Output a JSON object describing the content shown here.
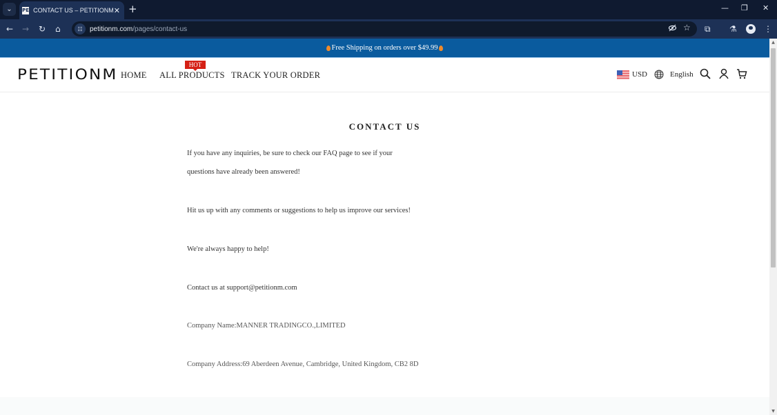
{
  "browser": {
    "tab_title": "CONTACT US – PETITIONM",
    "tab_favicon": "PE",
    "url_domain": "petitionm.com",
    "url_path": "/pages/contact-us",
    "icons": {
      "tab_menu": "⌄",
      "tab_close": "✕",
      "new_tab": "+",
      "minimize": "—",
      "restore": "❐",
      "close": "✕",
      "back": "←",
      "forward": "→",
      "reload": "↻",
      "home": "⌂",
      "site_info": "☷",
      "eye_off": "◌",
      "bookmark": "☆",
      "extensions": "⧉",
      "labs": "⚗",
      "menu": "⋮"
    }
  },
  "announcement": {
    "text": "Free Shipping on orders over $49.99"
  },
  "header": {
    "logo": "PETITIONM",
    "nav": [
      {
        "label": "HOME"
      },
      {
        "label": "ALL PRODUCTS",
        "badge": "HOT"
      },
      {
        "label": "TRACK YOUR ORDER"
      }
    ],
    "currency": "USD",
    "language": "English"
  },
  "main": {
    "title": "CONTACT US",
    "paragraphs": [
      "If you have any inquiries, be sure to check our FAQ page to see if your questions have already been answered!",
      "Hit us up with any comments or suggestions to help us improve our services!",
      "We're always happy to help!",
      "Contact us at support@petitionm.com",
      "Company Name:MANNER TRADINGCO.,LIMITED",
      "Company Address:69 Aberdeen Avenue, Cambridge, United Kingdom, CB2 8D"
    ]
  },
  "colors": {
    "announcement_bg": "#0a5b9e",
    "hot_badge": "#d52015",
    "chrome_dark": "#0f1a30",
    "chrome_toolbar": "#1d3156"
  }
}
